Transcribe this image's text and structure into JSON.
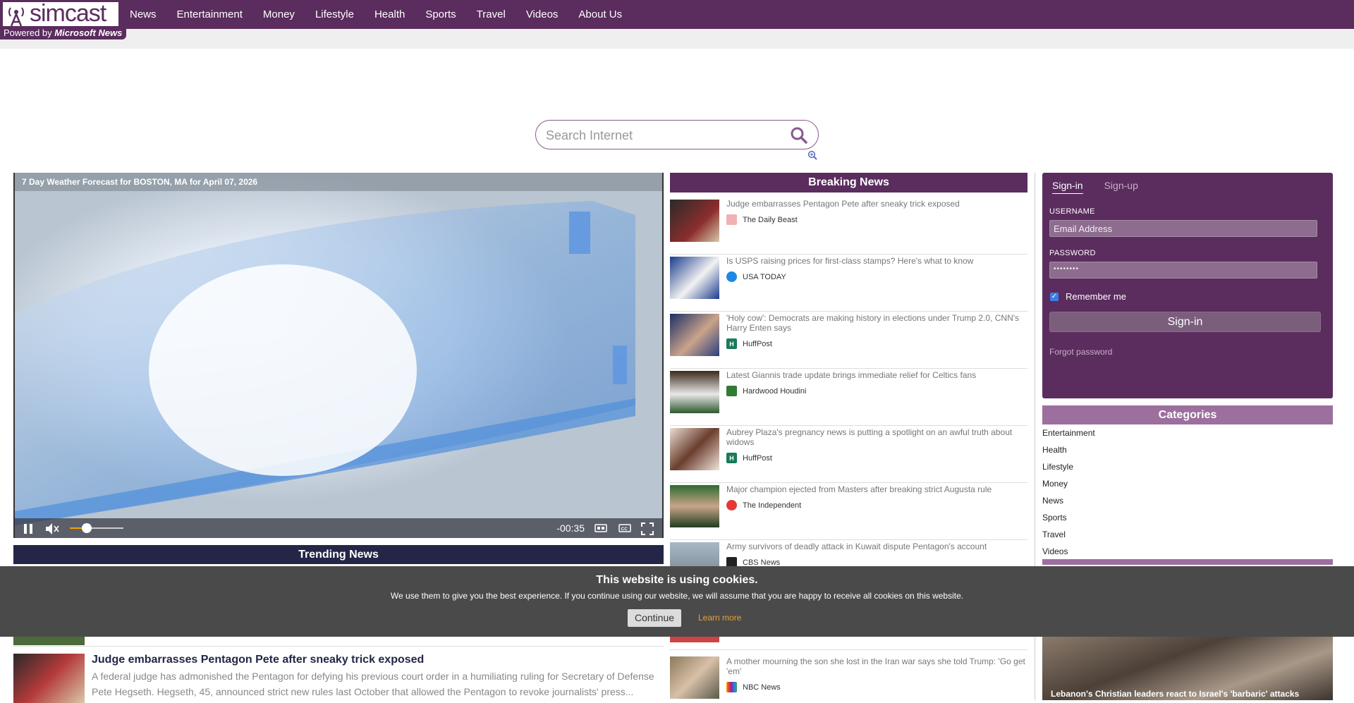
{
  "brand": {
    "logo_text": "simcast",
    "powered_prefix": "Powered by",
    "powered_brand": "Microsoft News"
  },
  "nav": [
    "News",
    "Entertainment",
    "Money",
    "Lifestyle",
    "Health",
    "Sports",
    "Travel",
    "Videos",
    "About Us"
  ],
  "search": {
    "placeholder": "Search Internet"
  },
  "video": {
    "title": "7 Day Weather Forecast for BOSTON, MA for April 07, 2026",
    "time": "-00:35"
  },
  "trending": {
    "header": "Trending News",
    "item_title": "Judge embarrasses Pentagon Pete after sneaky trick exposed",
    "item_desc": "A federal judge has admonished the Pentagon for defying his previous court order in a humiliating ruling for Secretary of Defense Pete Hegseth. Hegseth, 45, announced strict new rules last October that allowed the Pentagon to revoke journalists' press..."
  },
  "breaking": {
    "header": "Breaking News",
    "items": [
      {
        "title": "Judge embarrasses Pentagon Pete after sneaky trick exposed",
        "source": "The Daily Beast",
        "src_color": "#e57373"
      },
      {
        "title": "Is USPS raising prices for first-class stamps? Here's what to know",
        "source": "USA TODAY",
        "src_color": "#1e88e5"
      },
      {
        "title": "'Holy cow': Democrats are making history in elections under Trump 2.0, CNN's Harry Enten says",
        "source": "HuffPost",
        "src_color": "#1a7a5a"
      },
      {
        "title": "Latest Giannis trade update brings immediate relief for Celtics fans",
        "source": "Hardwood Houdini",
        "src_color": "#2e7d32"
      },
      {
        "title": "Aubrey Plaza's pregnancy news is putting a spotlight on an awful truth about widows",
        "source": "HuffPost",
        "src_color": "#1a7a5a"
      },
      {
        "title": "Major champion ejected from Masters after breaking strict Augusta rule",
        "source": "The Independent",
        "src_color": "#e53935"
      },
      {
        "title": "Army survivors of deadly attack in Kuwait dispute Pentagon's account",
        "source": "CBS News",
        "src_color": "#222222"
      }
    ],
    "bottom_item": {
      "title": "A mother mourning the son she lost in the Iran war says she told Trump: 'Go get 'em'",
      "source": "NBC News",
      "src_color": "#f4a300"
    }
  },
  "signin": {
    "tab_signin": "Sign-in",
    "tab_signup": "Sign-up",
    "username_label": "USERNAME",
    "username_placeholder": "Email Address",
    "password_label": "PASSWORD",
    "password_value": "••••••••",
    "remember_label": "Remember me",
    "button": "Sign-in",
    "forgot": "Forgot password"
  },
  "categories": {
    "header": "Categories",
    "items": [
      "Entertainment",
      "Health",
      "Lifestyle",
      "Money",
      "News",
      "Sports",
      "Travel",
      "Videos"
    ]
  },
  "cookie": {
    "title": "This website is using cookies.",
    "text": "We use them to give you the best experience. If you continue using our website, we will assume that you are happy to receive all cookies on this website.",
    "continue": "Continue",
    "learn_more": "Learn more"
  },
  "feature": {
    "caption": "Lebanon's Christian leaders react to Israel's 'barbaric' attacks"
  },
  "colors": {
    "brand": "#5b2c5e",
    "trending_header": "#232647",
    "category_header": "#9c6f9e",
    "cookie_bg": "#4a4a4a"
  }
}
